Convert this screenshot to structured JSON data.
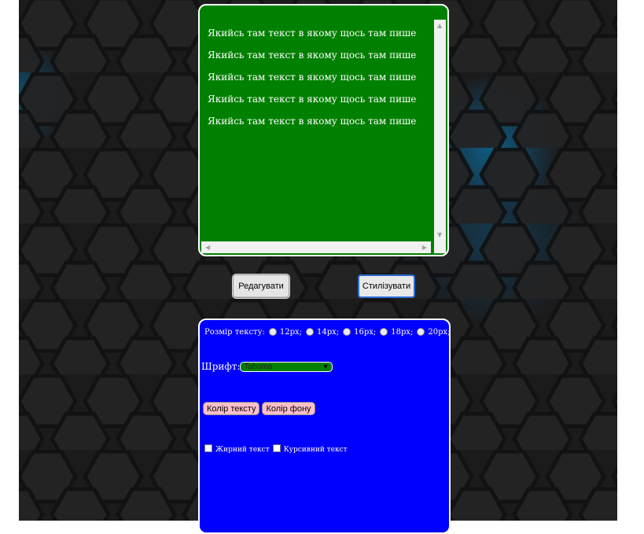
{
  "editor": {
    "lines": [
      "Якийсь там текст в якому щось там пише",
      "Якийсь там текст в якому щось там пише",
      "Якийсь там текст в якому щось там пише",
      "Якийсь там текст в якому щось там пише",
      "Якийсь там текст в якому щось там пише"
    ],
    "background": "#008000",
    "text_color": "#ffffff"
  },
  "actions": {
    "edit_label": "Редагувати",
    "stylize_label": "Стилізувати"
  },
  "style_panel": {
    "background": "#0000ff",
    "size_label": "Розмір тексту:",
    "sizes": [
      "12px;",
      "14px;",
      "16px;",
      "18px;",
      "20px;"
    ],
    "font_label": "Шрифт:",
    "font_selected": "Tahoma",
    "text_color_button": "Колір тексту",
    "bg_color_button": "Колір фону",
    "bold_label": "Жирний текст",
    "italic_label": "Курсивний текст"
  }
}
